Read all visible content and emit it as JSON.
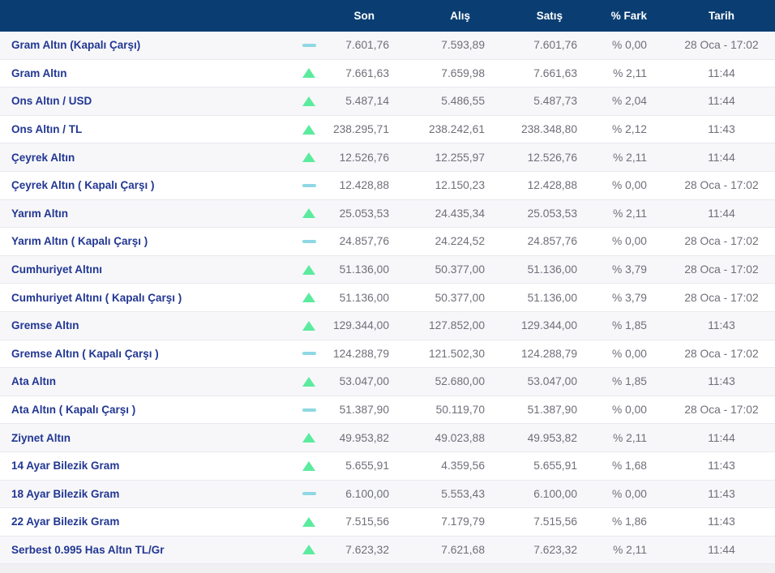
{
  "colors": {
    "header_bg": "#0a3e72",
    "name_text": "#223793",
    "value_text": "#6f6f7a",
    "border": "#e8e8ef",
    "row_alt": "#f7f7f9",
    "strip": "#f0f0f3",
    "up": "#5ceb9e",
    "flat": "#8fd8e3"
  },
  "table": {
    "columns": {
      "son": "Son",
      "alis": "Alış",
      "satis": "Satış",
      "fark": "% Fark",
      "tarih": "Tarih"
    },
    "rows": [
      {
        "name": "Gram Altın (Kapalı Çarşı)",
        "trend": "flat",
        "son": "7.601,76",
        "alis": "7.593,89",
        "satis": "7.601,76",
        "fark": "% 0,00",
        "tarih": "28 Oca - 17:02"
      },
      {
        "name": "Gram Altın",
        "trend": "up",
        "son": "7.661,63",
        "alis": "7.659,98",
        "satis": "7.661,63",
        "fark": "% 2,11",
        "tarih": "11:44"
      },
      {
        "name": "Ons Altın / USD",
        "trend": "up",
        "son": "5.487,14",
        "alis": "5.486,55",
        "satis": "5.487,73",
        "fark": "% 2,04",
        "tarih": "11:44"
      },
      {
        "name": "Ons Altın / TL",
        "trend": "up",
        "son": "238.295,71",
        "alis": "238.242,61",
        "satis": "238.348,80",
        "fark": "% 2,12",
        "tarih": "11:43"
      },
      {
        "name": "Çeyrek Altın",
        "trend": "up",
        "son": "12.526,76",
        "alis": "12.255,97",
        "satis": "12.526,76",
        "fark": "% 2,11",
        "tarih": "11:44"
      },
      {
        "name": "Çeyrek Altın ( Kapalı Çarşı )",
        "trend": "flat",
        "son": "12.428,88",
        "alis": "12.150,23",
        "satis": "12.428,88",
        "fark": "% 0,00",
        "tarih": "28 Oca - 17:02"
      },
      {
        "name": "Yarım Altın",
        "trend": "up",
        "son": "25.053,53",
        "alis": "24.435,34",
        "satis": "25.053,53",
        "fark": "% 2,11",
        "tarih": "11:44"
      },
      {
        "name": "Yarım Altın ( Kapalı Çarşı )",
        "trend": "flat",
        "son": "24.857,76",
        "alis": "24.224,52",
        "satis": "24.857,76",
        "fark": "% 0,00",
        "tarih": "28 Oca - 17:02"
      },
      {
        "name": "Cumhuriyet Altını",
        "trend": "up",
        "son": "51.136,00",
        "alis": "50.377,00",
        "satis": "51.136,00",
        "fark": "% 3,79",
        "tarih": "28 Oca - 17:02"
      },
      {
        "name": "Cumhuriyet Altını ( Kapalı Çarşı )",
        "trend": "up",
        "son": "51.136,00",
        "alis": "50.377,00",
        "satis": "51.136,00",
        "fark": "% 3,79",
        "tarih": "28 Oca - 17:02"
      },
      {
        "name": "Gremse Altın",
        "trend": "up",
        "son": "129.344,00",
        "alis": "127.852,00",
        "satis": "129.344,00",
        "fark": "% 1,85",
        "tarih": "11:43"
      },
      {
        "name": "Gremse Altın ( Kapalı Çarşı )",
        "trend": "flat",
        "son": "124.288,79",
        "alis": "121.502,30",
        "satis": "124.288,79",
        "fark": "% 0,00",
        "tarih": "28 Oca - 17:02"
      },
      {
        "name": "Ata Altın",
        "trend": "up",
        "son": "53.047,00",
        "alis": "52.680,00",
        "satis": "53.047,00",
        "fark": "% 1,85",
        "tarih": "11:43"
      },
      {
        "name": "Ata Altın ( Kapalı Çarşı )",
        "trend": "flat",
        "son": "51.387,90",
        "alis": "50.119,70",
        "satis": "51.387,90",
        "fark": "% 0,00",
        "tarih": "28 Oca - 17:02"
      },
      {
        "name": "Ziynet Altın",
        "trend": "up",
        "son": "49.953,82",
        "alis": "49.023,88",
        "satis": "49.953,82",
        "fark": "% 2,11",
        "tarih": "11:44"
      },
      {
        "name": "14 Ayar Bilezik Gram",
        "trend": "up",
        "son": "5.655,91",
        "alis": "4.359,56",
        "satis": "5.655,91",
        "fark": "% 1,68",
        "tarih": "11:43"
      },
      {
        "name": "18 Ayar Bilezik Gram",
        "trend": "flat",
        "son": "6.100,00",
        "alis": "5.553,43",
        "satis": "6.100,00",
        "fark": "% 0,00",
        "tarih": "11:43"
      },
      {
        "name": "22 Ayar Bilezik Gram",
        "trend": "up",
        "son": "7.515,56",
        "alis": "7.179,79",
        "satis": "7.515,56",
        "fark": "% 1,86",
        "tarih": "11:43"
      },
      {
        "name": "Serbest 0.995 Has Altın TL/Gr",
        "trend": "up",
        "son": "7.623,32",
        "alis": "7.621,68",
        "satis": "7.623,32",
        "fark": "% 2,11",
        "tarih": "11:44"
      }
    ]
  }
}
